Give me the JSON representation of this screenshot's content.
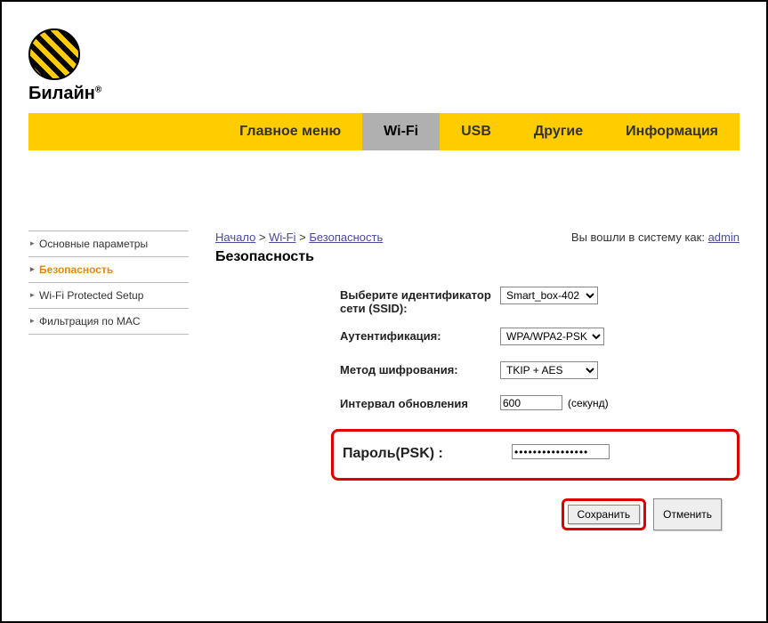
{
  "brand": "Билайн",
  "nav": {
    "tabs": [
      {
        "label": "Главное меню"
      },
      {
        "label": "Wi-Fi"
      },
      {
        "label": "USB"
      },
      {
        "label": "Другие"
      },
      {
        "label": "Информация"
      }
    ],
    "active_index": 1
  },
  "sidebar": {
    "items": [
      {
        "label": "Основные параметры"
      },
      {
        "label": "Безопасность"
      },
      {
        "label": "Wi-Fi Protected Setup"
      },
      {
        "label": "Фильтрация по MAC"
      }
    ],
    "active_index": 1
  },
  "breadcrumb": {
    "items": [
      "Начало",
      "Wi-Fi",
      "Безопасность"
    ],
    "sep": ">"
  },
  "login": {
    "text": "Вы вошли в систему как:",
    "user": "admin"
  },
  "page_title": "Безопасность",
  "form": {
    "ssid_label": "Выберите идентификатор сети (SSID):",
    "ssid_value": "Smart_box-402",
    "auth_label": "Аутентификация:",
    "auth_value": "WPA/WPA2-PSK",
    "enc_label": "Метод шифрования:",
    "enc_value": "TKIP + AES",
    "interval_label": "Интервал обновления",
    "interval_value": "600",
    "interval_unit": "(секунд)",
    "psk_label": "Пароль(PSK) :",
    "psk_value": "••••••••••••••••"
  },
  "buttons": {
    "save": "Сохранить",
    "cancel": "Отменить"
  }
}
